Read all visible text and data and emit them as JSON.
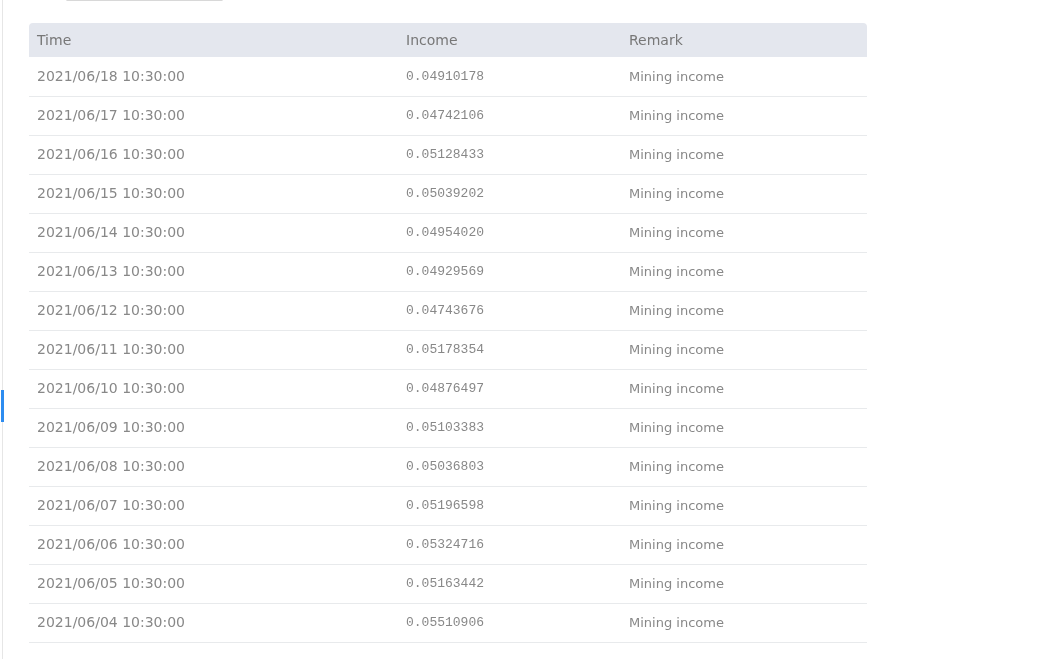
{
  "table": {
    "columns": [
      "Time",
      "Income",
      "Remark"
    ],
    "rows": [
      {
        "time": "2021/06/18 10:30:00",
        "income": "0.04910178",
        "remark": "Mining income"
      },
      {
        "time": "2021/06/17 10:30:00",
        "income": "0.04742106",
        "remark": "Mining income"
      },
      {
        "time": "2021/06/16 10:30:00",
        "income": "0.05128433",
        "remark": "Mining income"
      },
      {
        "time": "2021/06/15 10:30:00",
        "income": "0.05039202",
        "remark": "Mining income"
      },
      {
        "time": "2021/06/14 10:30:00",
        "income": "0.04954020",
        "remark": "Mining income"
      },
      {
        "time": "2021/06/13 10:30:00",
        "income": "0.04929569",
        "remark": "Mining income"
      },
      {
        "time": "2021/06/12 10:30:00",
        "income": "0.04743676",
        "remark": "Mining income"
      },
      {
        "time": "2021/06/11 10:30:00",
        "income": "0.05178354",
        "remark": "Mining income"
      },
      {
        "time": "2021/06/10 10:30:00",
        "income": "0.04876497",
        "remark": "Mining income"
      },
      {
        "time": "2021/06/09 10:30:00",
        "income": "0.05103383",
        "remark": "Mining income"
      },
      {
        "time": "2021/06/08 10:30:00",
        "income": "0.05036803",
        "remark": "Mining income"
      },
      {
        "time": "2021/06/07 10:30:00",
        "income": "0.05196598",
        "remark": "Mining income"
      },
      {
        "time": "2021/06/06 10:30:00",
        "income": "0.05324716",
        "remark": "Mining income"
      },
      {
        "time": "2021/06/05 10:30:00",
        "income": "0.05163442",
        "remark": "Mining income"
      },
      {
        "time": "2021/06/04 10:30:00",
        "income": "0.05510906",
        "remark": "Mining income"
      }
    ]
  }
}
